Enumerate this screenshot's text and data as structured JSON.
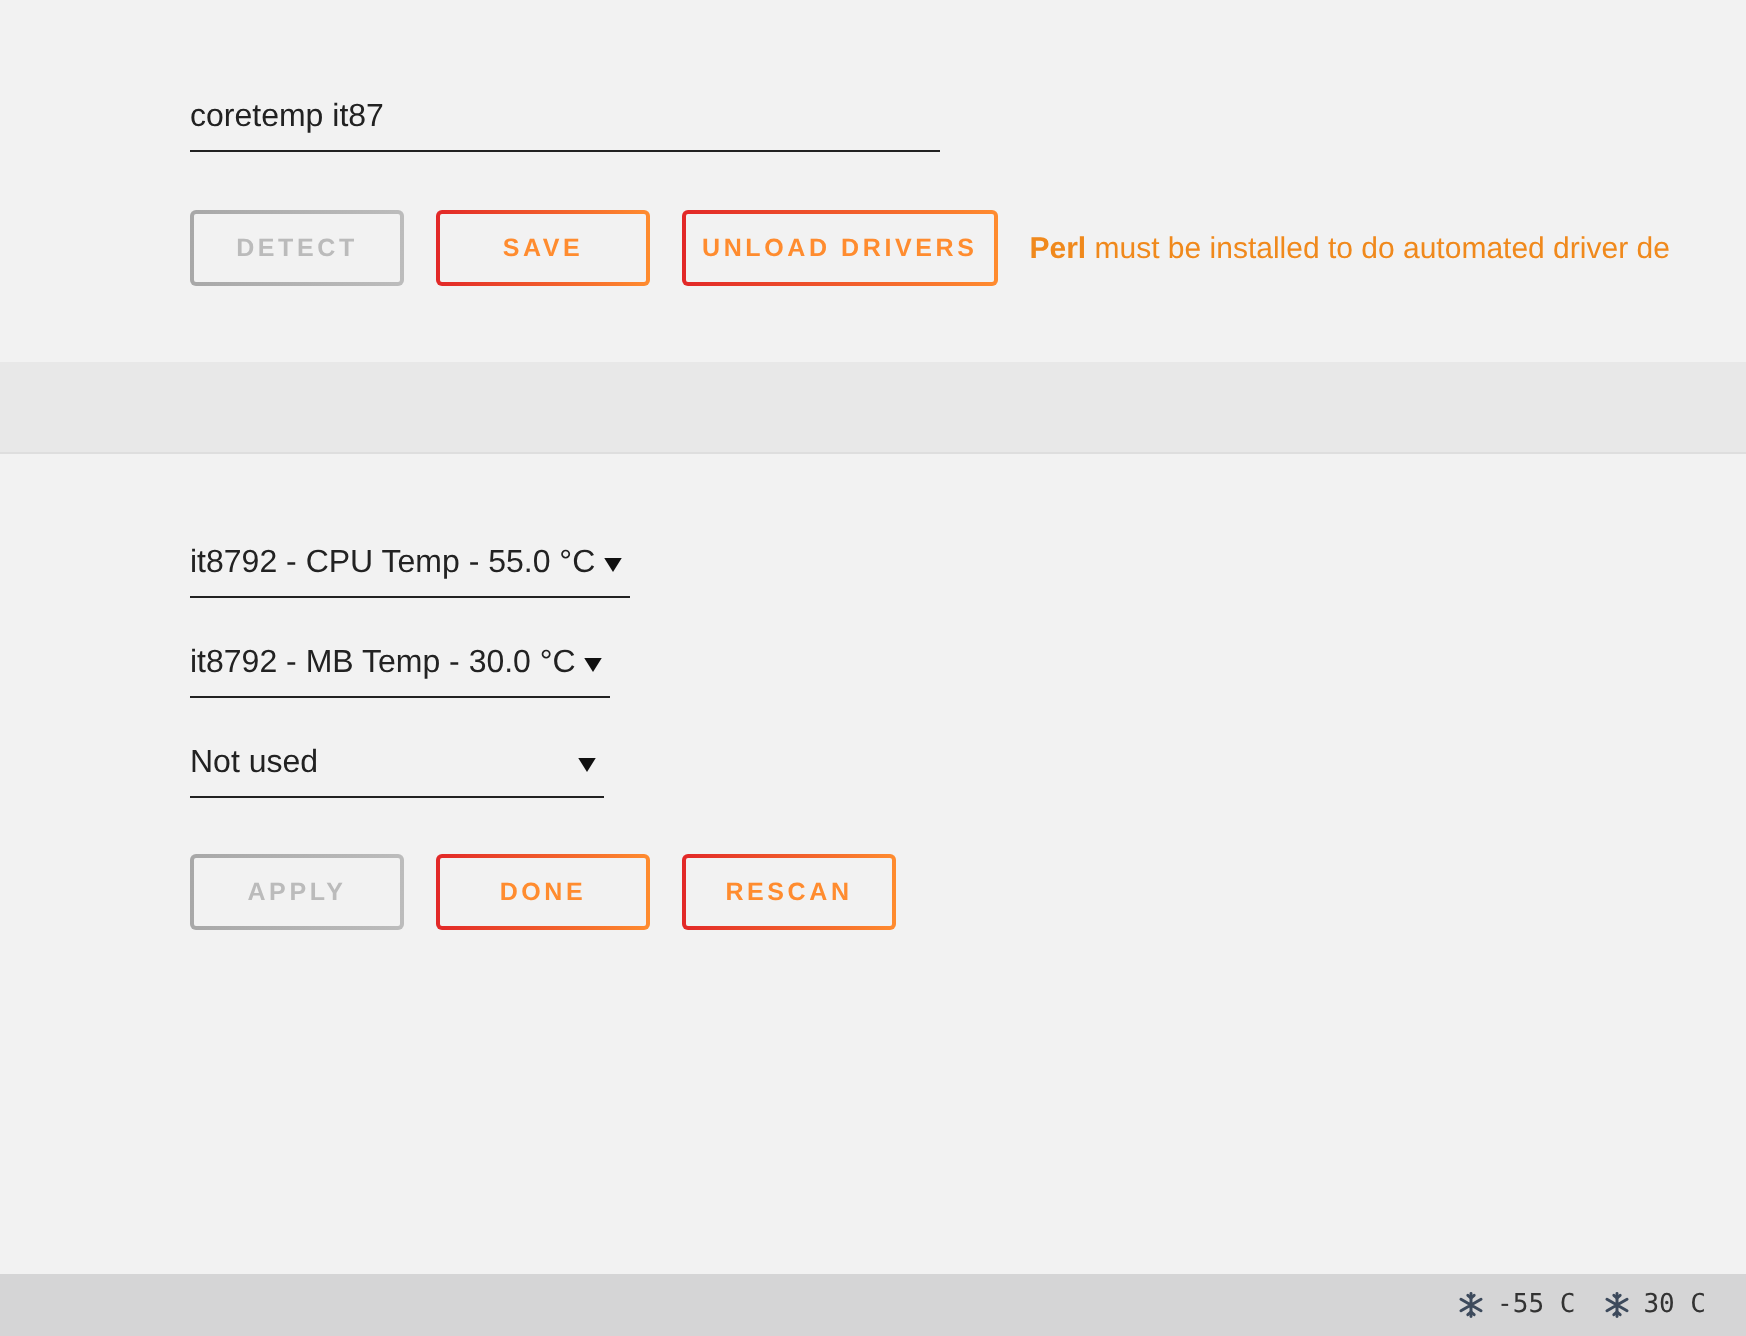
{
  "drivers_field": {
    "value": "coretemp it87"
  },
  "driver_buttons": [
    {
      "label": "DETECT",
      "disabled": true
    },
    {
      "label": "SAVE",
      "disabled": false
    },
    {
      "label": "UNLOAD DRIVERS",
      "disabled": false
    }
  ],
  "notice": "**Perl** must be installed to do automated driver de",
  "sensor_selects": [
    {
      "value": "it8792 - CPU Temp - 55.0 °C"
    },
    {
      "value": "it8792 - MB Temp - 30.0 °C"
    },
    {
      "value": "Not used"
    }
  ],
  "sensor_buttons": [
    {
      "label": "APPLY",
      "disabled": true
    },
    {
      "label": "DONE",
      "disabled": false
    },
    {
      "label": "RESCAN",
      "disabled": false
    }
  ],
  "status_bar": {
    "temps": [
      {
        "reading": "-55 C"
      },
      {
        "reading": "30 C"
      }
    ]
  }
}
